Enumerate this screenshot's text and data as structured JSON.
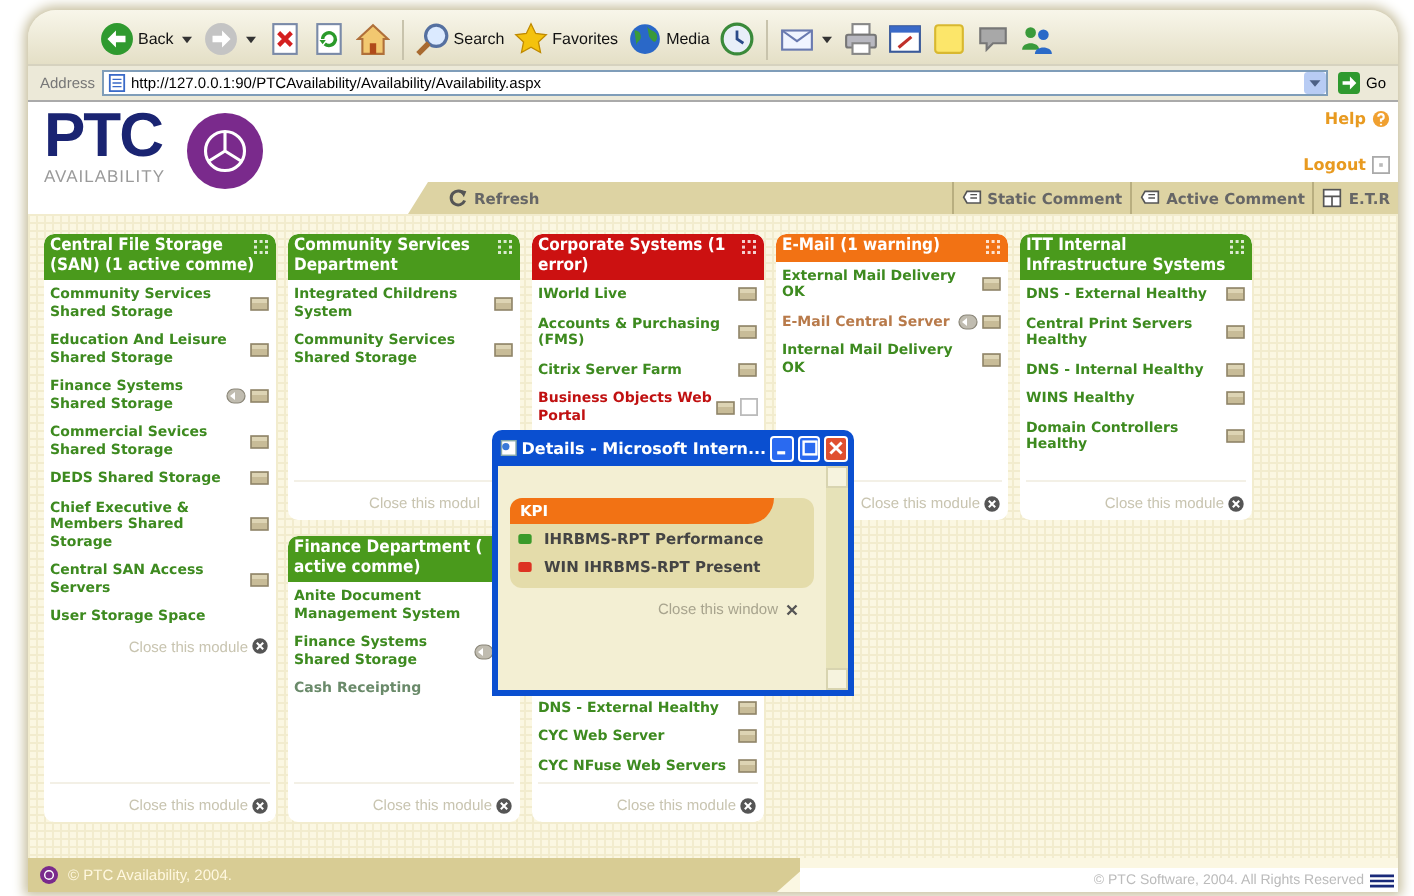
{
  "browser": {
    "toolbar": [
      {
        "kind": "back",
        "label": "Back",
        "dropdown": true
      },
      {
        "kind": "forward",
        "dropdown": true
      },
      {
        "kind": "stop",
        "dropdown": false
      },
      {
        "kind": "refresh",
        "dropdown": false
      },
      {
        "kind": "home",
        "dropdown": false
      },
      {
        "kind": "search",
        "label": "Search",
        "dropdown": false
      },
      {
        "kind": "favorites",
        "label": "Favorites",
        "dropdown": false
      },
      {
        "kind": "media",
        "label": "Media",
        "dropdown": false
      },
      {
        "kind": "history",
        "dropdown": false
      },
      {
        "kind": "mail",
        "dropdown": true
      },
      {
        "kind": "print",
        "dropdown": false
      },
      {
        "kind": "edit",
        "dropdown": false
      },
      {
        "kind": "notes",
        "dropdown": false
      },
      {
        "kind": "discuss",
        "dropdown": false
      },
      {
        "kind": "messenger",
        "dropdown": false
      }
    ],
    "address": {
      "label": "Address",
      "url": "http://127.0.0.1:90/PTCAvailability/Availability/Availability.aspx",
      "go": "Go"
    }
  },
  "header": {
    "logo_text": "PTC",
    "logo_sub": "AVAILABILITY",
    "help": "Help",
    "logout": "Logout"
  },
  "menu": {
    "refresh": "Refresh",
    "buttons": [
      {
        "label": "Static Comment",
        "kind": "comment"
      },
      {
        "label": "Active Comment",
        "kind": "comment"
      },
      {
        "label": "E.T.R",
        "kind": "etr"
      }
    ]
  },
  "columns": [
    {
      "modules": [
        {
          "title": "Central File Storage (SAN) (1 active comme)",
          "color": "#4a9a1c",
          "grip": true,
          "items": [
            {
              "label": "Community Services Shared Storage",
              "kind": "ok",
              "comment": false
            },
            {
              "label": "Education And Leisure Shared Storage",
              "kind": "ok",
              "comment": false
            },
            {
              "label": "Finance Systems Shared Storage",
              "kind": "ok",
              "comment": true
            },
            {
              "label": "Commercial Sevices Shared Storage",
              "kind": "ok",
              "comment": false
            },
            {
              "label": "DEDS Shared Storage",
              "kind": "ok",
              "comment": false
            },
            {
              "label": "Chief Executive & Members Shared Storage",
              "kind": "ok",
              "comment": false
            },
            {
              "label": "Central SAN Access Servers",
              "kind": "ok",
              "comment": false
            },
            {
              "label": "User Storage Space",
              "kind": "plain",
              "comment": false
            }
          ],
          "closes": [
            {
              "label": "Close this module",
              "icon": true
            },
            {
              "label": "Close this module",
              "icon": true
            }
          ]
        }
      ]
    },
    {
      "modules": [
        {
          "title": "Community Services Department",
          "color": "#4a9a1c",
          "grip": true,
          "items": [
            {
              "label": "Integrated Childrens System",
              "kind": "ok",
              "comment": false
            },
            {
              "label": "Community Services Shared Storage",
              "kind": "ok",
              "comment": false
            }
          ],
          "closes": [
            {
              "label": "Close this modul",
              "icon": false
            }
          ]
        },
        {
          "title": "Finance Department ( active comme)",
          "color": "#4a9a1c",
          "grip": false,
          "items": [
            {
              "label": "Anite Document Management System",
              "kind": "plain",
              "comment": false
            },
            {
              "label": "Finance Systems Shared Storage",
              "kind": "plain",
              "comment": true
            },
            {
              "label": "Cash Receipting",
              "kind": "unknown",
              "comment": false
            }
          ],
          "closes": [
            {
              "label": "Close this module",
              "icon": true
            }
          ]
        }
      ]
    },
    {
      "modules": [
        {
          "title": "Corporate Systems (1 error)",
          "color": "#cc1111",
          "grip": true,
          "items": [
            {
              "label": "IWorld Live",
              "kind": "ok",
              "comment": false
            },
            {
              "label": "Accounts & Purchasing (FMS)",
              "kind": "ok",
              "comment": false
            },
            {
              "label": "Citrix Server Farm",
              "kind": "ok",
              "comment": false
            },
            {
              "label": "Business Objects Web Portal",
              "kind": "error",
              "comment": false
            }
          ],
          "bottom_items": [
            {
              "label": "DNS - External Healthy",
              "kind": "ok",
              "comment": false
            },
            {
              "label": "CYC Web Server",
              "kind": "ok",
              "comment": false
            },
            {
              "label": "CYC NFuse Web Servers",
              "kind": "ok",
              "comment": false
            }
          ],
          "closes": [
            {
              "label": "Close this module",
              "icon": true
            }
          ]
        }
      ]
    },
    {
      "modules": [
        {
          "title": "E-Mail (1 warning)",
          "color": "#f27214",
          "grip": true,
          "items": [
            {
              "label": "External Mail Delivery OK",
              "kind": "ok",
              "comment": false
            },
            {
              "label": "E-Mail Central Server",
              "kind": "warning",
              "comment": true
            },
            {
              "label": "Internal Mail Delivery OK",
              "kind": "ok",
              "comment": false
            }
          ],
          "closes": [
            {
              "label": "Close this module",
              "icon": true
            }
          ]
        }
      ]
    },
    {
      "modules": [
        {
          "title": "ITT Internal Infrastructure Systems",
          "color": "#4a9a1c",
          "grip": true,
          "items": [
            {
              "label": "DNS - External Healthy",
              "kind": "ok",
              "comment": false
            },
            {
              "label": "Central Print Servers Healthy",
              "kind": "ok",
              "comment": false
            },
            {
              "label": "DNS - Internal Healthy",
              "kind": "ok",
              "comment": false
            },
            {
              "label": "WINS Healthy",
              "kind": "ok",
              "comment": false
            },
            {
              "label": "Domain Controllers Healthy",
              "kind": "ok",
              "comment": false
            }
          ],
          "closes": [
            {
              "label": "Close this module",
              "icon": true
            }
          ]
        }
      ]
    }
  ],
  "popup": {
    "title": "Details - Microsoft Intern...",
    "panel_title": "KPI",
    "items": [
      {
        "label": "IHRBMS-RPT Performance",
        "color": "#3a9a2a"
      },
      {
        "label": "WIN IHRBMS-RPT Present",
        "color": "#dd3322"
      }
    ],
    "close": "Close this window"
  },
  "footer": {
    "left": "© PTC Availability, 2004.",
    "right": "© PTC Software, 2004. All Rights Reserved"
  }
}
